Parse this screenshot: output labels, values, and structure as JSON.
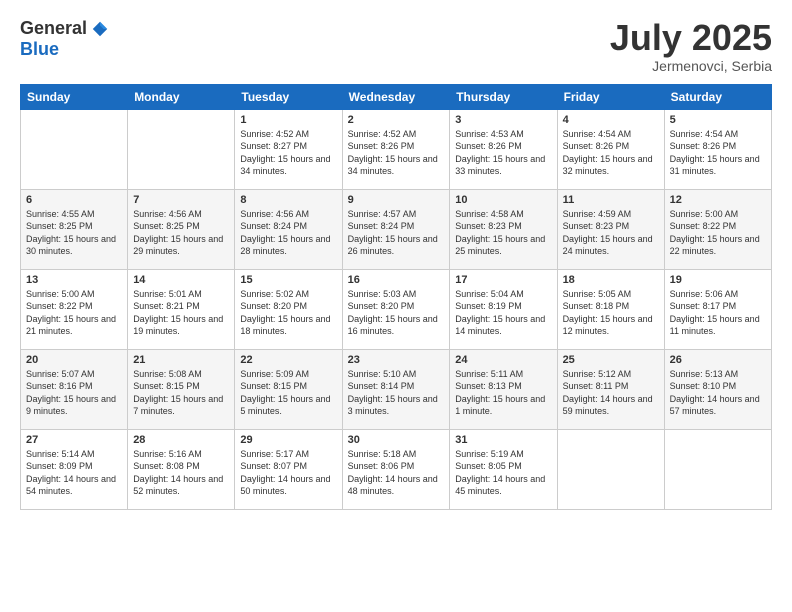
{
  "logo": {
    "general": "General",
    "blue": "Blue"
  },
  "header": {
    "month": "July 2025",
    "location": "Jermenovci, Serbia"
  },
  "weekdays": [
    "Sunday",
    "Monday",
    "Tuesday",
    "Wednesday",
    "Thursday",
    "Friday",
    "Saturday"
  ],
  "weeks": [
    [
      {
        "day": "",
        "sunrise": "",
        "sunset": "",
        "daylight": ""
      },
      {
        "day": "",
        "sunrise": "",
        "sunset": "",
        "daylight": ""
      },
      {
        "day": "1",
        "sunrise": "Sunrise: 4:52 AM",
        "sunset": "Sunset: 8:27 PM",
        "daylight": "Daylight: 15 hours and 34 minutes."
      },
      {
        "day": "2",
        "sunrise": "Sunrise: 4:52 AM",
        "sunset": "Sunset: 8:26 PM",
        "daylight": "Daylight: 15 hours and 34 minutes."
      },
      {
        "day": "3",
        "sunrise": "Sunrise: 4:53 AM",
        "sunset": "Sunset: 8:26 PM",
        "daylight": "Daylight: 15 hours and 33 minutes."
      },
      {
        "day": "4",
        "sunrise": "Sunrise: 4:54 AM",
        "sunset": "Sunset: 8:26 PM",
        "daylight": "Daylight: 15 hours and 32 minutes."
      },
      {
        "day": "5",
        "sunrise": "Sunrise: 4:54 AM",
        "sunset": "Sunset: 8:26 PM",
        "daylight": "Daylight: 15 hours and 31 minutes."
      }
    ],
    [
      {
        "day": "6",
        "sunrise": "Sunrise: 4:55 AM",
        "sunset": "Sunset: 8:25 PM",
        "daylight": "Daylight: 15 hours and 30 minutes."
      },
      {
        "day": "7",
        "sunrise": "Sunrise: 4:56 AM",
        "sunset": "Sunset: 8:25 PM",
        "daylight": "Daylight: 15 hours and 29 minutes."
      },
      {
        "day": "8",
        "sunrise": "Sunrise: 4:56 AM",
        "sunset": "Sunset: 8:24 PM",
        "daylight": "Daylight: 15 hours and 28 minutes."
      },
      {
        "day": "9",
        "sunrise": "Sunrise: 4:57 AM",
        "sunset": "Sunset: 8:24 PM",
        "daylight": "Daylight: 15 hours and 26 minutes."
      },
      {
        "day": "10",
        "sunrise": "Sunrise: 4:58 AM",
        "sunset": "Sunset: 8:23 PM",
        "daylight": "Daylight: 15 hours and 25 minutes."
      },
      {
        "day": "11",
        "sunrise": "Sunrise: 4:59 AM",
        "sunset": "Sunset: 8:23 PM",
        "daylight": "Daylight: 15 hours and 24 minutes."
      },
      {
        "day": "12",
        "sunrise": "Sunrise: 5:00 AM",
        "sunset": "Sunset: 8:22 PM",
        "daylight": "Daylight: 15 hours and 22 minutes."
      }
    ],
    [
      {
        "day": "13",
        "sunrise": "Sunrise: 5:00 AM",
        "sunset": "Sunset: 8:22 PM",
        "daylight": "Daylight: 15 hours and 21 minutes."
      },
      {
        "day": "14",
        "sunrise": "Sunrise: 5:01 AM",
        "sunset": "Sunset: 8:21 PM",
        "daylight": "Daylight: 15 hours and 19 minutes."
      },
      {
        "day": "15",
        "sunrise": "Sunrise: 5:02 AM",
        "sunset": "Sunset: 8:20 PM",
        "daylight": "Daylight: 15 hours and 18 minutes."
      },
      {
        "day": "16",
        "sunrise": "Sunrise: 5:03 AM",
        "sunset": "Sunset: 8:20 PM",
        "daylight": "Daylight: 15 hours and 16 minutes."
      },
      {
        "day": "17",
        "sunrise": "Sunrise: 5:04 AM",
        "sunset": "Sunset: 8:19 PM",
        "daylight": "Daylight: 15 hours and 14 minutes."
      },
      {
        "day": "18",
        "sunrise": "Sunrise: 5:05 AM",
        "sunset": "Sunset: 8:18 PM",
        "daylight": "Daylight: 15 hours and 12 minutes."
      },
      {
        "day": "19",
        "sunrise": "Sunrise: 5:06 AM",
        "sunset": "Sunset: 8:17 PM",
        "daylight": "Daylight: 15 hours and 11 minutes."
      }
    ],
    [
      {
        "day": "20",
        "sunrise": "Sunrise: 5:07 AM",
        "sunset": "Sunset: 8:16 PM",
        "daylight": "Daylight: 15 hours and 9 minutes."
      },
      {
        "day": "21",
        "sunrise": "Sunrise: 5:08 AM",
        "sunset": "Sunset: 8:15 PM",
        "daylight": "Daylight: 15 hours and 7 minutes."
      },
      {
        "day": "22",
        "sunrise": "Sunrise: 5:09 AM",
        "sunset": "Sunset: 8:15 PM",
        "daylight": "Daylight: 15 hours and 5 minutes."
      },
      {
        "day": "23",
        "sunrise": "Sunrise: 5:10 AM",
        "sunset": "Sunset: 8:14 PM",
        "daylight": "Daylight: 15 hours and 3 minutes."
      },
      {
        "day": "24",
        "sunrise": "Sunrise: 5:11 AM",
        "sunset": "Sunset: 8:13 PM",
        "daylight": "Daylight: 15 hours and 1 minute."
      },
      {
        "day": "25",
        "sunrise": "Sunrise: 5:12 AM",
        "sunset": "Sunset: 8:11 PM",
        "daylight": "Daylight: 14 hours and 59 minutes."
      },
      {
        "day": "26",
        "sunrise": "Sunrise: 5:13 AM",
        "sunset": "Sunset: 8:10 PM",
        "daylight": "Daylight: 14 hours and 57 minutes."
      }
    ],
    [
      {
        "day": "27",
        "sunrise": "Sunrise: 5:14 AM",
        "sunset": "Sunset: 8:09 PM",
        "daylight": "Daylight: 14 hours and 54 minutes."
      },
      {
        "day": "28",
        "sunrise": "Sunrise: 5:16 AM",
        "sunset": "Sunset: 8:08 PM",
        "daylight": "Daylight: 14 hours and 52 minutes."
      },
      {
        "day": "29",
        "sunrise": "Sunrise: 5:17 AM",
        "sunset": "Sunset: 8:07 PM",
        "daylight": "Daylight: 14 hours and 50 minutes."
      },
      {
        "day": "30",
        "sunrise": "Sunrise: 5:18 AM",
        "sunset": "Sunset: 8:06 PM",
        "daylight": "Daylight: 14 hours and 48 minutes."
      },
      {
        "day": "31",
        "sunrise": "Sunrise: 5:19 AM",
        "sunset": "Sunset: 8:05 PM",
        "daylight": "Daylight: 14 hours and 45 minutes."
      },
      {
        "day": "",
        "sunrise": "",
        "sunset": "",
        "daylight": ""
      },
      {
        "day": "",
        "sunrise": "",
        "sunset": "",
        "daylight": ""
      }
    ]
  ]
}
